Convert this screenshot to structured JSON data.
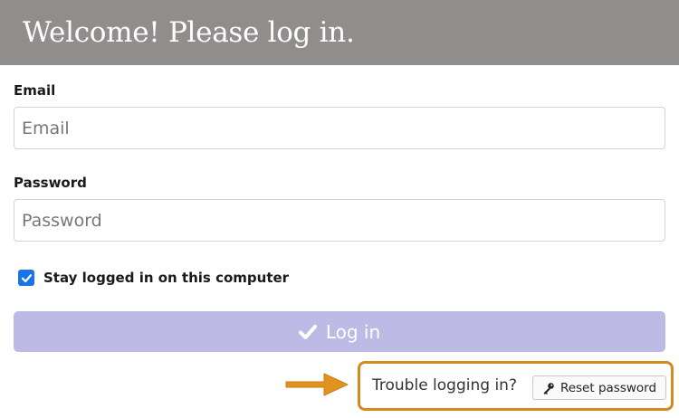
{
  "header": {
    "title": "Welcome! Please log in."
  },
  "form": {
    "email_label": "Email",
    "email_placeholder": "Email",
    "email_value": "",
    "password_label": "Password",
    "password_placeholder": "Password",
    "password_value": "",
    "remember_label": "Stay logged in on this computer",
    "remember_checked": true,
    "login_label": "Log in",
    "login_icon": "check-icon"
  },
  "help": {
    "trouble_text": "Trouble logging in?",
    "reset_label": "Reset password",
    "reset_icon": "key-icon"
  },
  "colors": {
    "header_bg": "#8f8e8c",
    "login_button_bg": "#bdbbe6",
    "checkbox_accent": "#1a73e8",
    "highlight_border": "#d68a1c",
    "arrow": "#e0941f"
  }
}
